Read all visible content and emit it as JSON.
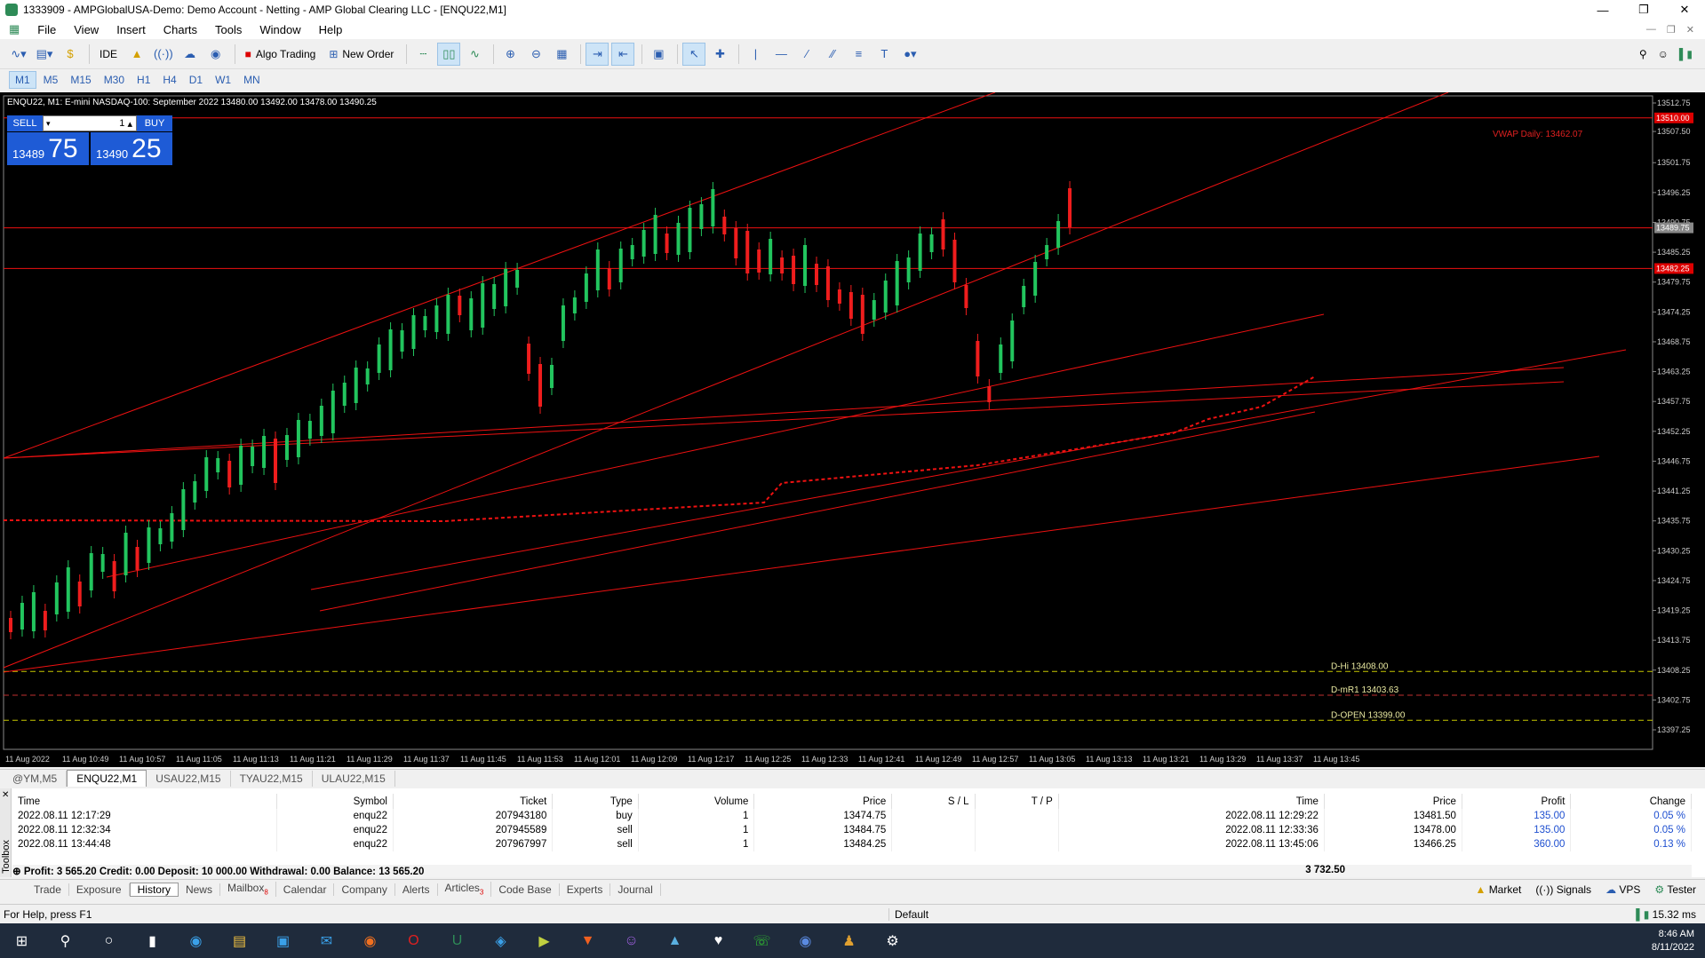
{
  "window": {
    "title": "1333909 - AMPGlobalUSA-Demo: Demo Account - Netting - AMP Global Clearing LLC - [ENQU22,M1]"
  },
  "menu": [
    "File",
    "View",
    "Insert",
    "Charts",
    "Tools",
    "Window",
    "Help"
  ],
  "toolbar": {
    "ide": "IDE",
    "algo": "Algo Trading",
    "neworder": "New Order"
  },
  "timeframes": [
    "M1",
    "M5",
    "M15",
    "M30",
    "H1",
    "H4",
    "D1",
    "W1",
    "MN"
  ],
  "chart": {
    "header": "ENQU22, M1:  E-mini NASDAQ-100: September 2022  13480.00 13492.00 13478.00 13490.25",
    "sell_label": "SELL",
    "buy_label": "BUY",
    "quantity": "1",
    "sell_small": "13489",
    "sell_big": "75",
    "buy_small": "13490",
    "buy_big": "25",
    "vwap_label": "VWAP Daily: 13462.07",
    "level_labels": [
      "D-Hi 13408.00",
      "D-mR1 13403.63",
      "D-OPEN 13399.00"
    ],
    "price_ticks": [
      "13512.75",
      "13507.50",
      "13501.75",
      "13496.25",
      "13490.75",
      "13485.25",
      "13479.75",
      "13474.25",
      "13468.75",
      "13463.25",
      "13457.75",
      "13452.25",
      "13446.75",
      "13441.25",
      "13435.75",
      "13430.25",
      "13424.75",
      "13419.25",
      "13413.75",
      "13408.25",
      "13402.75",
      "13397.25"
    ],
    "price_marks": [
      "13510.00",
      "13489.75",
      "13482.25"
    ],
    "time_ticks": [
      "11 Aug 2022",
      "11 Aug 10:49",
      "11 Aug 10:57",
      "11 Aug 11:05",
      "11 Aug 11:13",
      "11 Aug 11:21",
      "11 Aug 11:29",
      "11 Aug 11:37",
      "11 Aug 11:45",
      "11 Aug 11:53",
      "11 Aug 12:01",
      "11 Aug 12:09",
      "11 Aug 12:17",
      "11 Aug 12:25",
      "11 Aug 12:33",
      "11 Aug 12:41",
      "11 Aug 12:49",
      "11 Aug 12:57",
      "11 Aug 13:05",
      "11 Aug 13:13",
      "11 Aug 13:21",
      "11 Aug 13:29",
      "11 Aug 13:37",
      "11 Aug 13:45"
    ],
    "colors": {
      "bull": "#22c55e",
      "bear": "#ef1d1d",
      "line": "#e11",
      "level": "#c8c800"
    }
  },
  "symbol_tabs": [
    "@YM,M5",
    "ENQU22,M1",
    "USAU22,M15",
    "TYAU22,M15",
    "ULAU22,M15"
  ],
  "history": {
    "columns": [
      "Time",
      "Symbol",
      "Ticket",
      "Type",
      "Volume",
      "Price",
      "S / L",
      "T / P",
      "Time",
      "Price",
      "Profit",
      "Change"
    ],
    "rows": [
      [
        "2022.08.11 12:17:29",
        "enqu22",
        "207943180",
        "buy",
        "1",
        "13474.75",
        "",
        "",
        "2022.08.11 12:29:22",
        "13481.50",
        "135.00",
        "0.05 %"
      ],
      [
        "2022.08.11 12:32:34",
        "enqu22",
        "207945589",
        "sell",
        "1",
        "13484.75",
        "",
        "",
        "2022.08.11 12:33:36",
        "13478.00",
        "135.00",
        "0.05 %"
      ],
      [
        "2022.08.11 13:44:48",
        "enqu22",
        "207967997",
        "sell",
        "1",
        "13484.25",
        "",
        "",
        "2022.08.11 13:45:06",
        "13466.25",
        "360.00",
        "0.13 %"
      ]
    ],
    "summary": "Profit: 3 565.20  Credit: 0.00  Deposit: 10 000.00  Withdrawal: 0.00  Balance: 13 565.20",
    "total": "3 732.50",
    "toolbox": "Toolbox"
  },
  "bottom_tabs": [
    "Trade",
    "Exposure",
    "History",
    "News",
    "Mailbox",
    "Calendar",
    "Company",
    "Alerts",
    "Articles",
    "Code Base",
    "Experts",
    "Journal"
  ],
  "mailbox_badge": "8",
  "articles_badge": "3",
  "right_tabs": [
    "Market",
    "Signals",
    "VPS",
    "Tester"
  ],
  "status": {
    "help": "For Help, press F1",
    "profile": "Default",
    "ping": "15.32 ms"
  },
  "clock": {
    "time": "8:46 AM",
    "date": "8/11/2022"
  }
}
